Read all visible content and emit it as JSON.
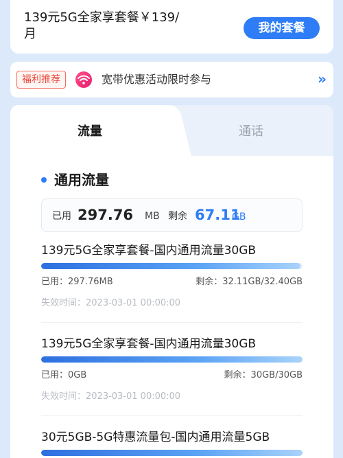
{
  "header": {
    "plan_title": "139元5G全家享套餐￥139/月",
    "my_plan_button": "我的套餐"
  },
  "promo": {
    "tag": "福利推荐",
    "icon": "wifi-icon",
    "text": "宽带优惠活动限时参与",
    "arrow": "»"
  },
  "tabs": [
    {
      "label": "流量",
      "active": true
    },
    {
      "label": "通话",
      "active": false
    }
  ],
  "section": {
    "title": "通用流量"
  },
  "summary": {
    "used_label": "已用",
    "used_value": "297.76",
    "used_unit": "MB",
    "remain_label": "剩余",
    "remain_value": "67.11",
    "remain_unit": "GB"
  },
  "packages": [
    {
      "name": "139元5G全家享套餐-国内通用流量30GB",
      "used": "已用：297.76MB",
      "remain": "剩余：32.11GB/32.40GB",
      "expire": "失效时间：2023-03-01 00:00:00",
      "remain_fraction": 0.991
    },
    {
      "name": "139元5G全家享套餐-国内通用流量30GB",
      "used": "已用：0GB",
      "remain": "剩余：30GB/30GB",
      "expire": "失效时间：2023-03-01 00:00:00",
      "remain_fraction": 1.0
    },
    {
      "name": "30元5GB-5G特惠流量包-国内通用流量5GB",
      "remain_fraction": 1.0
    }
  ],
  "colors": {
    "accent": "#2e7df6",
    "promo_tag": "#e94b3b",
    "background": "#dbe9fb"
  }
}
